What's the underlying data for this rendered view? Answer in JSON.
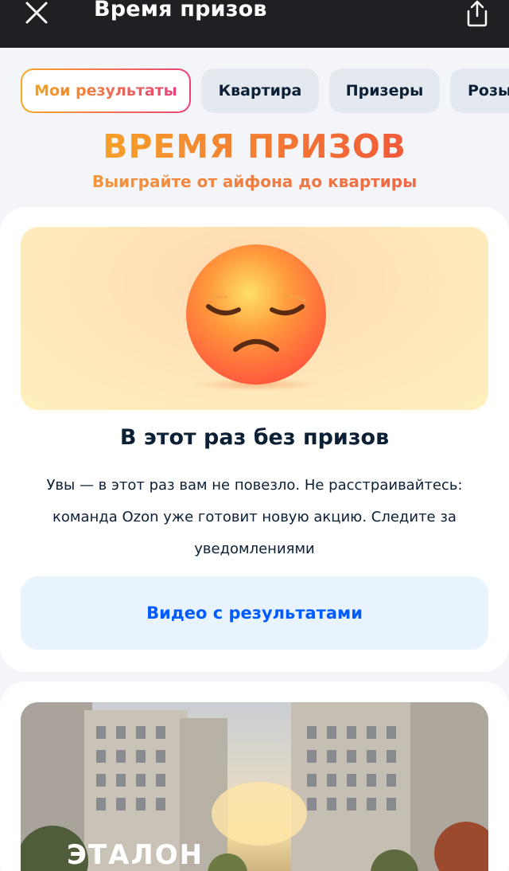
{
  "header": {
    "title": "Время призов",
    "close_icon": "close-icon",
    "share_icon": "share-icon"
  },
  "tabs": [
    {
      "label": "Мои результаты",
      "active": true
    },
    {
      "label": "Квартира",
      "active": false
    },
    {
      "label": "Призеры",
      "active": false
    },
    {
      "label": "Розы",
      "active": false
    }
  ],
  "promo": {
    "title": "ВРЕМЯ ПРИЗОВ",
    "subtitle": "Выиграйте от айфона до квартиры"
  },
  "result_card": {
    "image_icon": "sad-face-emoji",
    "heading": "В этот раз без призов",
    "body": "Увы — в этот раз вам не повезло. Не расстраивайтесь: команда Ozon уже готовит новую акцию. Следите за уведомлениями",
    "button_label": "Видео с результатами"
  },
  "banner": {
    "logo_text": "ЭТАЛОН"
  },
  "colors": {
    "topbar": "#1f2023",
    "accent_blue": "#005bff",
    "gradient_start": "#f6a12a",
    "gradient_end": "#ec407a"
  }
}
